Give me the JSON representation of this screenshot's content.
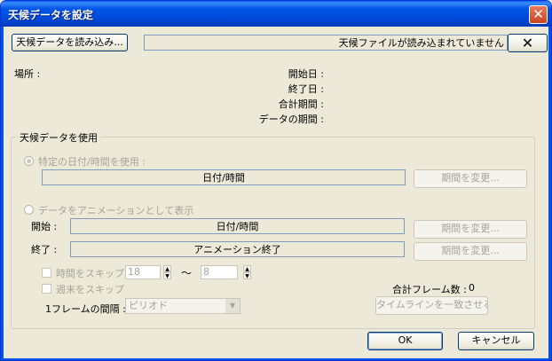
{
  "window": {
    "title": "天候データを設定",
    "close_glyph": "✕"
  },
  "top": {
    "load_button": "天候データを読み込み...",
    "status": "天候ファイルが読み込まれていません",
    "clear_glyph": "✕"
  },
  "info": {
    "location_label": "場所 :",
    "start_label": "開始日 :",
    "end_label": "終了日 :",
    "total_label": "合計期間 :",
    "period_label": "データの期間 :"
  },
  "group": {
    "title": "天候データを使用",
    "specific_radio": "特定の日付/時間を使用 :",
    "specific_field": "日付/時間",
    "change_period_1": "期間を変更...",
    "anim_radio": "データをアニメーションとして表示",
    "start_label": "開始 :",
    "start_field": "日付/時間",
    "change_period_2": "期間を変更...",
    "end_label": "終了 :",
    "end_field": "アニメーション終了",
    "change_period_3": "期間を変更...",
    "skip_hours_label": "時間をスキップ",
    "skip_from": "18",
    "tilde": "〜",
    "skip_to": "8",
    "skip_weekends_label": "週末をスキップ",
    "interval_label": "1フレームの間隔 :",
    "interval_value": "ピリオド",
    "total_frames_label": "合計フレーム数 :",
    "total_frames_value": "0",
    "match_timeline": "タイムラインを一致させる"
  },
  "footer": {
    "ok": "OK",
    "cancel": "キャンセル"
  },
  "colors": {
    "titlebar": "#0055e5",
    "face": "#ece9d8",
    "close": "#c84622"
  }
}
